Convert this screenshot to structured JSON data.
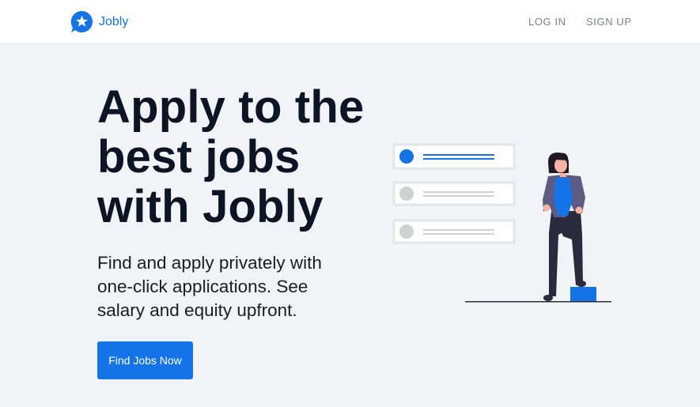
{
  "nav": {
    "brand": "Jobly",
    "login": "LOG IN",
    "signup": "SIGN UP"
  },
  "hero": {
    "title": "Apply to the best jobs with Jobly",
    "subtitle": "Find and apply privately with one-click applications. See salary and equity upfront.",
    "cta": "Find Jobs Now"
  },
  "colors": {
    "brand": "#1473e6",
    "background": "#f2f3f6",
    "heading": "#0d1424"
  },
  "icons": {
    "logo": "star-chat-bubble-icon"
  }
}
